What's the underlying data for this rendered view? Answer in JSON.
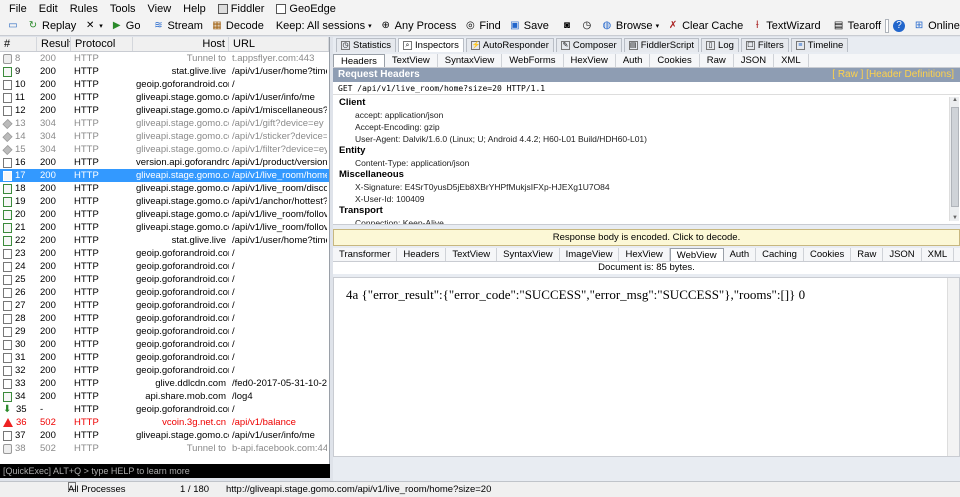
{
  "menu": [
    "File",
    "Edit",
    "Rules",
    "Tools",
    "View",
    "Help",
    "Fiddler",
    "GeoEdge"
  ],
  "toolbar": {
    "replay": "Replay",
    "go": "Go",
    "stream": "Stream",
    "decode": "Decode",
    "keep": "Keep: All sessions",
    "any_process": "Any Process",
    "find": "Find",
    "save": "Save",
    "browse": "Browse",
    "clear_cache": "Clear Cache",
    "textwizard": "TextWizard",
    "tearoff": "Tearoff",
    "msdn_placeholder": "MSDN Search...",
    "online": "Online"
  },
  "sessions": {
    "columns": [
      "#",
      "Result",
      "Protocol",
      "Host",
      "URL"
    ],
    "rows": [
      {
        "id": "8",
        "result": "200",
        "protocol": "HTTP",
        "host": "Tunnel to",
        "url": "t.appsflyer.com:443",
        "style": "gray",
        "icon": "lock"
      },
      {
        "id": "9",
        "result": "200",
        "protocol": "HTTP",
        "host": "stat.glive.live",
        "url": "/api/v1/user/home?time",
        "style": "",
        "icon": "js"
      },
      {
        "id": "10",
        "result": "200",
        "protocol": "HTTP",
        "host": "geoip.goforandroid.com",
        "url": "/",
        "style": "",
        "icon": "doc"
      },
      {
        "id": "11",
        "result": "200",
        "protocol": "HTTP",
        "host": "gliveapi.stage.gomo.com",
        "url": "/api/v1/user/info/me",
        "style": "",
        "icon": "doc"
      },
      {
        "id": "12",
        "result": "200",
        "protocol": "HTTP",
        "host": "gliveapi.stage.gomo.com",
        "url": "/api/v1/miscellaneous?c",
        "style": "",
        "icon": "doc"
      },
      {
        "id": "13",
        "result": "304",
        "protocol": "HTTP",
        "host": "gliveapi.stage.gomo.com",
        "url": "/api/v1/gift?device=ey",
        "style": "gray",
        "icon": "diam"
      },
      {
        "id": "14",
        "result": "304",
        "protocol": "HTTP",
        "host": "gliveapi.stage.gomo.com",
        "url": "/api/v1/sticker?device=",
        "style": "gray",
        "icon": "diam"
      },
      {
        "id": "15",
        "result": "304",
        "protocol": "HTTP",
        "host": "gliveapi.stage.gomo.com",
        "url": "/api/v1/filter?device=ey",
        "style": "gray",
        "icon": "diam"
      },
      {
        "id": "16",
        "result": "200",
        "protocol": "HTTP",
        "host": "version.api.goforandroid.c...",
        "url": "/api/v1/product/version",
        "style": "",
        "icon": "doc"
      },
      {
        "id": "17",
        "result": "200",
        "protocol": "HTTP",
        "host": "gliveapi.stage.gomo.com",
        "url": "/api/v1/live_room/home",
        "style": "sel",
        "icon": "js"
      },
      {
        "id": "18",
        "result": "200",
        "protocol": "HTTP",
        "host": "gliveapi.stage.gomo.com",
        "url": "/api/v1/live_room/disco",
        "style": "",
        "icon": "js"
      },
      {
        "id": "19",
        "result": "200",
        "protocol": "HTTP",
        "host": "gliveapi.stage.gomo.com",
        "url": "/api/v1/anchor/hottest?",
        "style": "",
        "icon": "js"
      },
      {
        "id": "20",
        "result": "200",
        "protocol": "HTTP",
        "host": "gliveapi.stage.gomo.com",
        "url": "/api/v1/live_room/follov",
        "style": "",
        "icon": "js"
      },
      {
        "id": "21",
        "result": "200",
        "protocol": "HTTP",
        "host": "gliveapi.stage.gomo.com",
        "url": "/api/v1/live_room/follov",
        "style": "",
        "icon": "js"
      },
      {
        "id": "22",
        "result": "200",
        "protocol": "HTTP",
        "host": "stat.glive.live",
        "url": "/api/v1/user/home?time",
        "style": "",
        "icon": "js"
      },
      {
        "id": "23",
        "result": "200",
        "protocol": "HTTP",
        "host": "geoip.goforandroid.com",
        "url": "/",
        "style": "",
        "icon": "doc"
      },
      {
        "id": "24",
        "result": "200",
        "protocol": "HTTP",
        "host": "geoip.goforandroid.com",
        "url": "/",
        "style": "",
        "icon": "doc"
      },
      {
        "id": "25",
        "result": "200",
        "protocol": "HTTP",
        "host": "geoip.goforandroid.com",
        "url": "/",
        "style": "",
        "icon": "doc"
      },
      {
        "id": "26",
        "result": "200",
        "protocol": "HTTP",
        "host": "geoip.goforandroid.com",
        "url": "/",
        "style": "",
        "icon": "doc"
      },
      {
        "id": "27",
        "result": "200",
        "protocol": "HTTP",
        "host": "geoip.goforandroid.com",
        "url": "/",
        "style": "",
        "icon": "doc"
      },
      {
        "id": "28",
        "result": "200",
        "protocol": "HTTP",
        "host": "geoip.goforandroid.com",
        "url": "/",
        "style": "",
        "icon": "doc"
      },
      {
        "id": "29",
        "result": "200",
        "protocol": "HTTP",
        "host": "geoip.goforandroid.com",
        "url": "/",
        "style": "",
        "icon": "doc"
      },
      {
        "id": "30",
        "result": "200",
        "protocol": "HTTP",
        "host": "geoip.goforandroid.com",
        "url": "/",
        "style": "",
        "icon": "doc"
      },
      {
        "id": "31",
        "result": "200",
        "protocol": "HTTP",
        "host": "geoip.goforandroid.com",
        "url": "/",
        "style": "",
        "icon": "doc"
      },
      {
        "id": "32",
        "result": "200",
        "protocol": "HTTP",
        "host": "geoip.goforandroid.com",
        "url": "/",
        "style": "",
        "icon": "doc"
      },
      {
        "id": "33",
        "result": "200",
        "protocol": "HTTP",
        "host": "glive.ddlcdn.com",
        "url": "/fed0-2017-05-31-10-2",
        "style": "",
        "icon": "doc"
      },
      {
        "id": "34",
        "result": "200",
        "protocol": "HTTP",
        "host": "api.share.mob.com",
        "url": "/log4",
        "style": "",
        "icon": "js"
      },
      {
        "id": "35",
        "result": "-",
        "protocol": "HTTP",
        "host": "geoip.goforandroid.com",
        "url": "/",
        "style": "",
        "icon": "down"
      },
      {
        "id": "36",
        "result": "502",
        "protocol": "HTTP",
        "host": "vcoin.3g.net.cn",
        "url": "/api/v1/balance",
        "style": "red",
        "icon": "warn"
      },
      {
        "id": "37",
        "result": "200",
        "protocol": "HTTP",
        "host": "gliveapi.stage.gomo.com",
        "url": "/api/v1/user/info/me",
        "style": "",
        "icon": "doc"
      },
      {
        "id": "38",
        "result": "502",
        "protocol": "HTTP",
        "host": "Tunnel to",
        "url": "b-api.facebook.com:44",
        "style": "gray",
        "icon": "lock"
      }
    ]
  },
  "quickexec": "[QuickExec] ALT+Q > type HELP to learn more",
  "status": {
    "processes": "All Processes",
    "count": "1 / 180",
    "url": "http://gliveapi.stage.gomo.com/api/v1/live_room/home?size=20"
  },
  "inspector": {
    "tabs": [
      "Statistics",
      "Inspectors",
      "AutoResponder",
      "Composer",
      "FiddlerScript",
      "Log",
      "Filters",
      "Timeline"
    ],
    "request_tabs": [
      "Headers",
      "TextView",
      "SyntaxView",
      "WebForms",
      "HexView",
      "Auth",
      "Cookies",
      "Raw",
      "JSON",
      "XML"
    ],
    "title": "Request Headers",
    "links": "[ Raw ]   [Header Definitions]",
    "request_line": "GET /api/v1/live_room/home?size=20 HTTP/1.1",
    "groups": [
      {
        "name": "Client",
        "items": [
          "accept: application/json",
          "Accept-Encoding: gzip",
          "User-Agent: Dalvik/1.6.0 (Linux; U; Android 4.4.2; H60-L01 Build/HDH60-L01)"
        ]
      },
      {
        "name": "Entity",
        "items": [
          "Content-Type: application/json"
        ]
      },
      {
        "name": "Miscellaneous",
        "items": [
          "X-Signature: E4SrT0yusD5jEb8XBrYHPfMukjsIFXp-HJEXg1U7O84",
          "X-User-Id: 100409"
        ]
      },
      {
        "name": "Transport",
        "items": [
          "Connection: Keep-Alive"
        ]
      }
    ],
    "notice": "Response body is encoded. Click to decode.",
    "response_tabs": [
      "Transformer",
      "Headers",
      "TextView",
      "SyntaxView",
      "ImageView",
      "HexView",
      "WebView",
      "Auth",
      "Caching",
      "Cookies",
      "Raw",
      "JSON",
      "XML"
    ],
    "doc_size": "Document is: 85 bytes.",
    "response_text": "4a {\"error_result\":{\"error_code\":\"SUCCESS\",\"error_msg\":\"SUCCESS\"},\"rooms\":[]} 0"
  }
}
